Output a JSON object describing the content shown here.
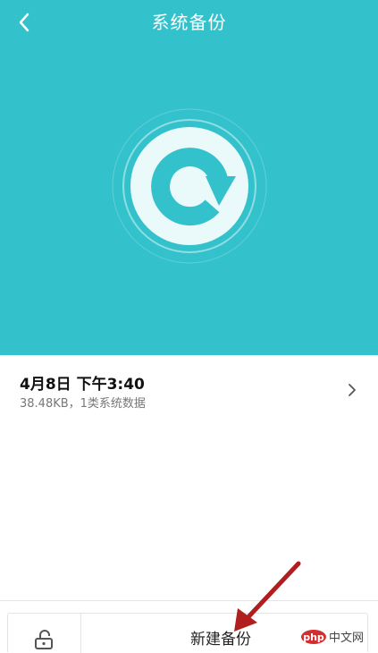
{
  "header": {
    "title": "系统备份",
    "back_icon": "chevron-left-icon"
  },
  "hero": {
    "background_color": "#33c2cc",
    "logo_icon": "backup-refresh-icon"
  },
  "backup_record": {
    "title": "4月8日 下午3:40",
    "subtitle": "38.48KB，1类系统数据",
    "chevron_icon": "chevron-right-icon"
  },
  "bottom_bar": {
    "lock_icon": "unlock-icon",
    "new_backup_label": "新建备份"
  },
  "annotation": {
    "arrow_color": "#b01e1e",
    "arrow_icon": "red-arrow-icon"
  },
  "watermark": {
    "text": "php中文网"
  }
}
